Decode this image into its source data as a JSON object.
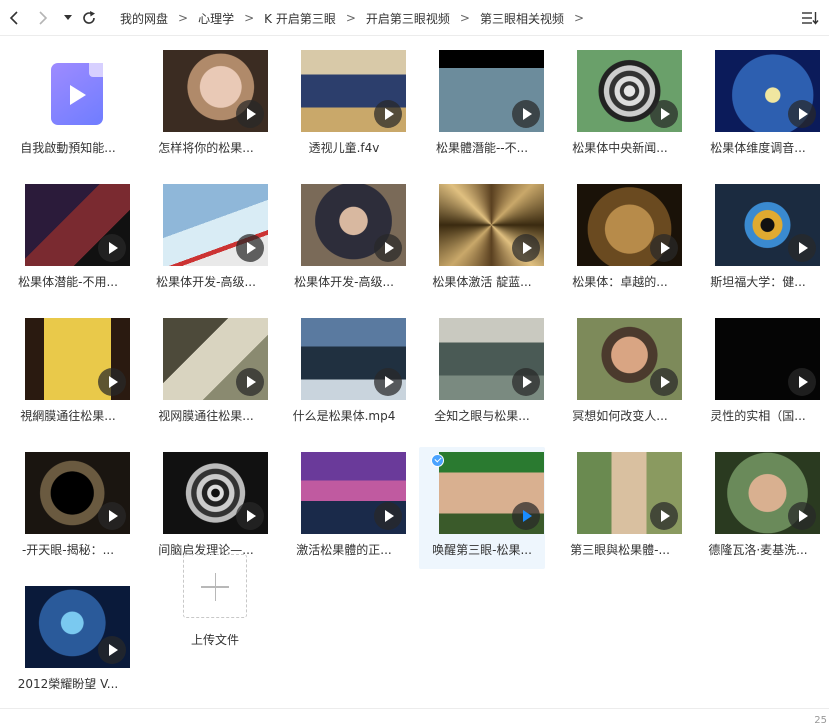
{
  "toolbar": {
    "back_icon": "chevron-left-icon",
    "forward_icon": "chevron-right-icon",
    "history_icon": "caret-down-icon",
    "refresh_icon": "refresh-icon",
    "sort_icon": "sort-list-icon"
  },
  "breadcrumb": [
    "我的网盘",
    "心理学",
    "K 开启第三眼",
    "开启第三眼视频",
    "第三眼相关视频"
  ],
  "breadcrumb_separator": ">",
  "files": [
    {
      "name": "自我啟動預知能...",
      "kind": "video-file"
    },
    {
      "name": "怎样将你的松果...",
      "kind": "thumb"
    },
    {
      "name": "透视儿童.f4v",
      "kind": "thumb"
    },
    {
      "name": "松果體潛能--不...",
      "kind": "thumb"
    },
    {
      "name": "松果体中央新闻...",
      "kind": "thumb"
    },
    {
      "name": "松果体维度调音...",
      "kind": "thumb"
    },
    {
      "name": "松果体潜能-不用...",
      "kind": "thumb"
    },
    {
      "name": "松果体开发-高级...",
      "kind": "thumb"
    },
    {
      "name": "松果体开发-高级...",
      "kind": "thumb"
    },
    {
      "name": "松果体激活 靛蓝...",
      "kind": "thumb"
    },
    {
      "name": "松果体：卓越的...",
      "kind": "thumb"
    },
    {
      "name": "斯坦福大学：健...",
      "kind": "thumb"
    },
    {
      "name": "視網膜通往松果...",
      "kind": "thumb"
    },
    {
      "name": "视网膜通往松果...",
      "kind": "thumb"
    },
    {
      "name": "什么是松果体.mp4",
      "kind": "thumb"
    },
    {
      "name": "全知之眼与松果...",
      "kind": "thumb"
    },
    {
      "name": "冥想如何改变人...",
      "kind": "thumb"
    },
    {
      "name": "灵性的实相（国...",
      "kind": "thumb"
    },
    {
      "name": "-开天眼-揭秘：...",
      "kind": "thumb"
    },
    {
      "name": "间脑启发理论—...",
      "kind": "thumb"
    },
    {
      "name": "激活松果體的正...",
      "kind": "thumb"
    },
    {
      "name": "唤醒第三眼-松果...",
      "kind": "thumb",
      "selected": true
    },
    {
      "name": "第三眼與松果體-...",
      "kind": "thumb"
    },
    {
      "name": "德隆瓦洛·麦基洗...",
      "kind": "thumb"
    },
    {
      "name": "2012榮耀盼望 V...",
      "kind": "thumb"
    }
  ],
  "upload": {
    "label": "上传文件",
    "icon": "plus-icon"
  },
  "status": {
    "count": "25"
  },
  "colors": {
    "selected_bg": "#eef6fd",
    "file_icon": "#7d82ff",
    "check": "#4aa3ff"
  }
}
